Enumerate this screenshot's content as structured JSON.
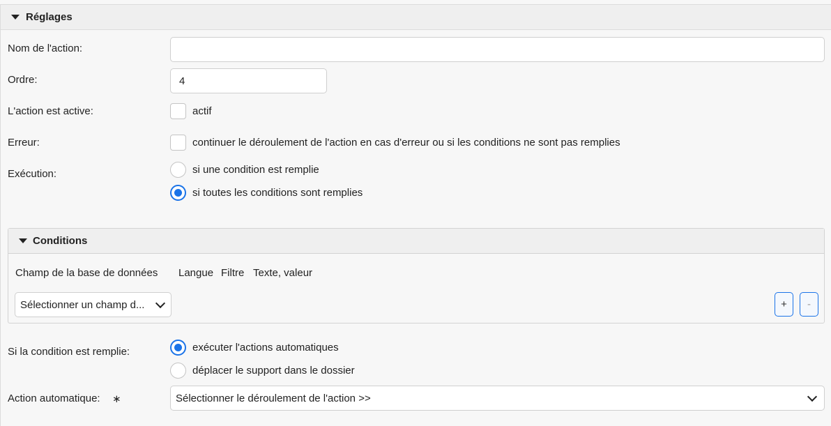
{
  "settings": {
    "title": "Réglages",
    "action_name_label": "Nom de l'action:",
    "action_name_value": "",
    "order_label": "Ordre:",
    "order_value": "4",
    "active_label": "L'action est active:",
    "active_checkbox_label": "actif",
    "error_label": "Erreur:",
    "error_checkbox_label": "continuer le déroulement de l'action en cas d'erreur ou si les conditions ne sont pas remplies",
    "execution_label": "Exécution:",
    "execution_options": [
      {
        "label": "si une condition est remplie",
        "selected": false
      },
      {
        "label": "si toutes les conditions sont remplies",
        "selected": true
      }
    ]
  },
  "conditions": {
    "title": "Conditions",
    "columns": [
      "Champ de la base de données",
      "Langue",
      "Filtre",
      "Texte, valeur"
    ],
    "field_select_value": "Sélectionner un champ d...",
    "add_label": "+",
    "remove_label": "-"
  },
  "on_condition": {
    "label": "Si la condition est remplie:",
    "options": [
      {
        "label": "exécuter l'actions automatiques",
        "selected": true
      },
      {
        "label": "déplacer le support dans le dossier",
        "selected": false
      }
    ]
  },
  "automatic_action": {
    "label": "Action automatique:",
    "required_mark": "∗",
    "select_value": "Sélectionner le déroulement de l'action >>"
  },
  "colors": {
    "accent": "#1a73e8",
    "background": "#f7f7f7",
    "header_background": "#efefef"
  }
}
